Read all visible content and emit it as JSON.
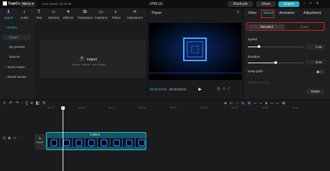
{
  "app": {
    "logo_text": "CapCut",
    "menu_label": "Menu",
    "autosave_text": "Auto saved: 19:45:45",
    "project_title": "0706 (1)",
    "shortcuts_label": "Shortcuts",
    "share_label": "Share",
    "export_label": "Export"
  },
  "tool_tabs": [
    {
      "label": "Import",
      "icon": "import-icon"
    },
    {
      "label": "Audio",
      "icon": "music-icon"
    },
    {
      "label": "Text",
      "icon": "text-icon"
    },
    {
      "label": "Stickers",
      "icon": "sticker-icon"
    },
    {
      "label": "Effects",
      "icon": "effects-icon"
    },
    {
      "label": "Transitions",
      "icon": "transitions-icon"
    },
    {
      "label": "Captions",
      "icon": "captions-icon"
    },
    {
      "label": "Filters",
      "icon": "filters-icon"
    },
    {
      "label": "Adjustment",
      "icon": "adjustment-icon"
    }
  ],
  "sidebar": {
    "items": [
      "Device",
      "Import",
      "My presets",
      "Spaces",
      "Stock mater...",
      "Brand assets"
    ]
  },
  "media": {
    "import_label": "Import",
    "import_sub": "Videos, audios, and images"
  },
  "player": {
    "title": "Player",
    "time_current": "00:00:00:25",
    "time_total": "00:00:06:02"
  },
  "inspector": {
    "tabs": [
      "Video",
      "Speed",
      "Animation",
      "Adjustment"
    ],
    "segments": [
      "Standard",
      "Curve"
    ],
    "speed_label": "Speed",
    "speed_value": "1.0x",
    "speed_level": 0.2,
    "duration_label": "Duration",
    "duration_value": "6.1s",
    "duration_level": 0.5,
    "keep_pitch_label": "Keep pitch",
    "smooth_label": "Smooth slow-mo",
    "reset_label": "Reset"
  },
  "timeline": {
    "ticks": [
      "00:00",
      "00:05",
      "00:10",
      "00:15",
      "00:20",
      "00:25",
      "00:30",
      "00:35",
      "00:40"
    ],
    "cover_label": "Cover",
    "clip_speed": "1.00x"
  },
  "colors": {
    "accent": "#27c2d6",
    "export": "#18b3c6",
    "highlight_box": "#e02020"
  }
}
